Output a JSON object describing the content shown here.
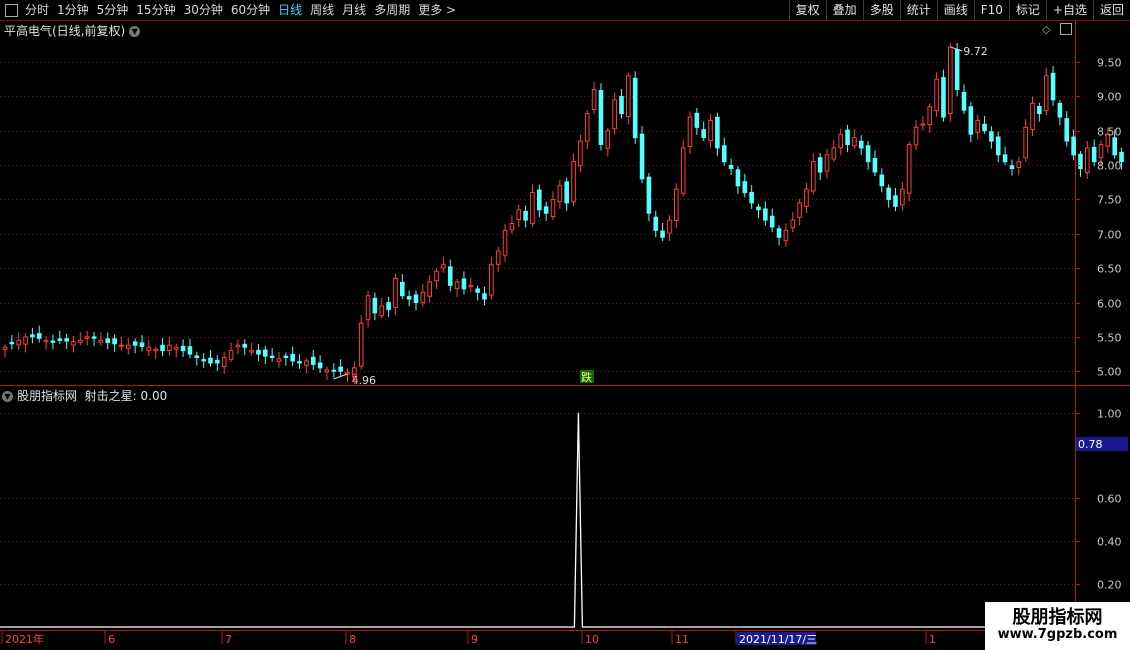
{
  "toolbar": {
    "periods": [
      "分时",
      "1分钟",
      "5分钟",
      "15分钟",
      "30分钟",
      "60分钟",
      "日线",
      "周线",
      "月线",
      "多周期",
      "更多 >"
    ],
    "active_index": 6,
    "actions": [
      "复权",
      "叠加",
      "多股",
      "统计",
      "画线",
      "F10",
      "标记",
      "+自选",
      "返回"
    ]
  },
  "main_panel": {
    "title": "平高电气(日线,前复权)",
    "high_label": "9.72",
    "low_label": "4.96",
    "signal_up": "$",
    "signal_down": "跌",
    "y_ticks": [
      "9.50",
      "9.00",
      "8.50",
      "8.00",
      "7.50",
      "7.00",
      "6.50",
      "6.00",
      "5.50",
      "5.00"
    ]
  },
  "indicator_panel": {
    "title": "股朋指标网",
    "indicator_name": "射击之星",
    "indicator_value": "0.00",
    "cursor_value": "0.78",
    "y_ticks": [
      "1.00",
      "0.60",
      "0.40",
      "0.20"
    ]
  },
  "date_axis": {
    "labels": [
      "2021年",
      "6",
      "7",
      "8",
      "9",
      "10",
      "11",
      "2021/11/17/三",
      "1"
    ],
    "cursor_date": "2021/11/17/三"
  },
  "watermark": {
    "line1": "股朋指标网",
    "line2": "www.7gpzb.com"
  },
  "colors": {
    "up": "#ff3c3c",
    "down": "#54ffff",
    "grid": "#6e1414",
    "active": "#35d6ff"
  },
  "chart_data": [
    {
      "type": "candlestick",
      "title": "平高电气(日线,前复权)",
      "ylim": [
        4.8,
        9.85
      ],
      "annotations": {
        "high": 9.72,
        "low": 4.96
      },
      "close_approx": [
        5.35,
        5.4,
        5.45,
        5.5,
        5.5,
        5.48,
        5.45,
        5.42,
        5.45,
        5.44,
        5.43,
        5.45,
        5.5,
        5.48,
        5.45,
        5.42,
        5.4,
        5.38,
        5.38,
        5.38,
        5.36,
        5.35,
        5.32,
        5.3,
        5.38,
        5.35,
        5.3,
        5.25,
        5.2,
        5.15,
        5.12,
        5.12,
        5.2,
        5.3,
        5.38,
        5.35,
        5.3,
        5.25,
        5.22,
        5.2,
        5.18,
        5.2,
        5.15,
        5.12,
        5.15,
        5.1,
        5.05,
        5.02,
        5.0,
        5.0,
        4.98,
        5.05,
        5.7,
        6.1,
        5.85,
        5.95,
        5.9,
        6.35,
        6.1,
        6.05,
        6.0,
        6.15,
        6.3,
        6.45,
        6.55,
        6.25,
        6.3,
        6.2,
        6.25,
        6.15,
        6.05,
        6.55,
        6.75,
        7.05,
        7.15,
        7.35,
        7.2,
        7.6,
        7.35,
        7.3,
        7.5,
        7.7,
        7.45,
        8.05,
        8.35,
        8.75,
        9.1,
        8.3,
        8.5,
        8.95,
        8.75,
        9.3,
        8.4,
        7.8,
        7.3,
        7.05,
        6.95,
        7.2,
        7.65,
        8.25,
        8.7,
        8.55,
        8.4,
        8.65,
        8.25,
        8.05,
        7.95,
        7.7,
        7.6,
        7.45,
        7.35,
        7.2,
        7.1,
        6.95,
        7.05,
        7.2,
        7.45,
        7.65,
        8.05,
        7.9,
        8.15,
        8.25,
        8.45,
        8.3,
        8.4,
        8.25,
        8.05,
        7.9,
        7.7,
        7.5,
        7.4,
        7.65,
        8.3,
        8.55,
        8.6,
        8.85,
        9.25,
        8.7,
        9.72,
        9.1,
        8.8,
        8.45,
        8.65,
        8.5,
        8.35,
        8.15,
        8.05,
        7.95,
        8.05,
        8.55,
        8.9,
        8.75,
        9.3,
        8.95,
        8.7,
        8.35,
        8.15,
        7.95,
        8.25,
        8.05,
        8.3,
        8.45,
        8.15,
        8.05
      ]
    },
    {
      "type": "line",
      "title": "射击之星",
      "ylim": [
        0,
        1.05
      ],
      "x_index_of_peak": 84,
      "peak_value": 1.0,
      "baseline": 0.0
    }
  ]
}
